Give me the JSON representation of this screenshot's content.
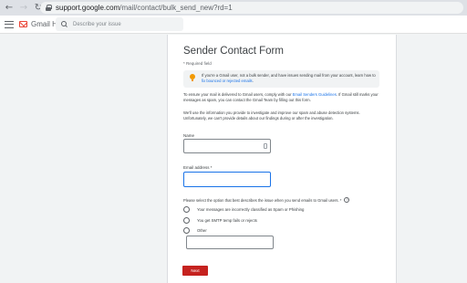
{
  "browser": {
    "url_host": "support.google.com",
    "url_path": "/mail/contact/bulk_send_new?rd=1",
    "back_icon": "arrow-left-icon",
    "forward_icon": "arrow-right-icon",
    "reload_icon": "reload-icon"
  },
  "header": {
    "title": "Gmail Help",
    "search_placeholder": "Describe your issue"
  },
  "form": {
    "title": "Sender Contact Form",
    "required_note": "* Required field",
    "info_text_1": "If you're a Gmail user, not a bulk sender, and have issues sending mail from your account, learn how to ",
    "info_link": "fix bounced or rejected emails",
    "info_text_2": ".",
    "para1_text_1": "To ensure your mail is delivered to Gmail users, comply with our ",
    "para1_link": "Email Senders Guidelines",
    "para1_text_2": ". If Gmail still marks your messages as spam, you can contact the Gmail Team by filling out this form.",
    "para2": "We'll use the information you provide to investigate and improve our spam and abuse detection systems. Unfortunately, we can't provide details about our findings during or after the investigation.",
    "name_label": "Name",
    "email_label": "Email address *",
    "question": "Please select the option that best describes the issue when you send emails to Gmail users. *",
    "options": [
      "Your messages are incorrectly classified as Spam or Phishing",
      "You get SMTP temp fails or rejects",
      "Other"
    ],
    "next_label": "Next"
  },
  "colors": {
    "accent": "#1a73e8",
    "button": "#c5221f",
    "info_icon": "#f29900"
  }
}
